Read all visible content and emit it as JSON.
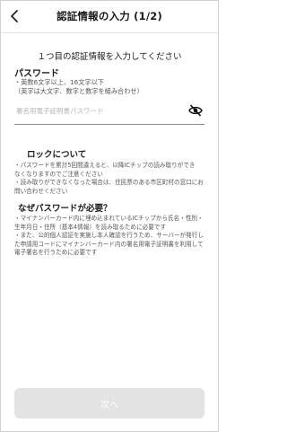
{
  "header": {
    "title": "認証情報の入力 (1/2)"
  },
  "lead": "１つ目の認証情報を入力してください",
  "password": {
    "label": "パスワード",
    "hint_line1": "・英数6文字以上、16文字以下",
    "hint_line2": "（英字は大文字、数字と数字を組み合わせ）",
    "placeholder": "署名用電子証明書パスワード",
    "value": ""
  },
  "lock": {
    "title": "ロックについて",
    "line1": "・パスワードを累計5回間違えると、以降ICチップの読み取りができ",
    "line2": "なくなりますのでご注意ください",
    "line3": "・読み取りができなくなった場合は、住民票のある市区町村の窓口にお",
    "line4": "問い合わせください"
  },
  "why": {
    "title": "なぜパスワードが必要？",
    "line1": "・マイナンバーカード内に埋め込まれているICチップから氏名・性別・",
    "line2": "生年月日・住所（基本4情報）を読み取るために必要です",
    "line3": "・また、公的個人認証を実施し本人確認を行うため、サーバーが発行し",
    "line4": "た申請用コードにマイナンバーカード内の署名用電子証明書を利用して",
    "line5": "電子署名を行うために必要です"
  },
  "next_button": "次へ",
  "colors": {
    "button_disabled": "#e3e3e3",
    "text": "#1a1a1a",
    "subtext": "#555555"
  },
  "icons": {
    "back": "chevron-left-icon",
    "visibility": "eye-off-icon"
  }
}
